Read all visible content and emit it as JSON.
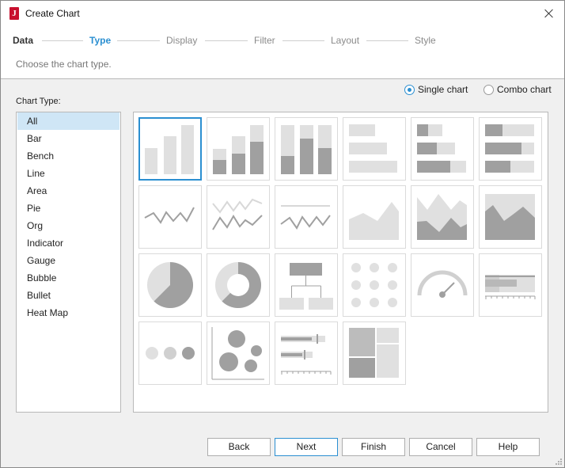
{
  "window": {
    "title": "Create Chart",
    "icon": "jreport-icon"
  },
  "steps": [
    "Data",
    "Type",
    "Display",
    "Filter",
    "Layout",
    "Style"
  ],
  "active_step": "Type",
  "subtitle": "Choose the chart type.",
  "mode_options": {
    "single": "Single chart",
    "combo": "Combo chart",
    "selected": "Single chart"
  },
  "chart_type_label": "Chart Type:",
  "chart_types": [
    "All",
    "Bar",
    "Bench",
    "Line",
    "Area",
    "Pie",
    "Org",
    "Indicator",
    "Gauge",
    "Bubble",
    "Bullet",
    "Heat Map"
  ],
  "selected_type": "All",
  "gallery": [
    {
      "icon": "bar-chart-icon"
    },
    {
      "icon": "stacked-bar-chart-icon"
    },
    {
      "icon": "stacked-bar-100-chart-icon"
    },
    {
      "icon": "bench-chart-icon"
    },
    {
      "icon": "stacked-bench-chart-icon"
    },
    {
      "icon": "stacked-bench-100-chart-icon"
    },
    {
      "icon": "line-chart-icon"
    },
    {
      "icon": "multi-line-chart-icon"
    },
    {
      "icon": "line-with-reference-chart-icon"
    },
    {
      "icon": "area-chart-icon"
    },
    {
      "icon": "stacked-area-chart-icon"
    },
    {
      "icon": "area-100-chart-icon"
    },
    {
      "icon": "pie-chart-icon"
    },
    {
      "icon": "donut-chart-icon"
    },
    {
      "icon": "org-chart-icon"
    },
    {
      "icon": "indicator-dots-icon"
    },
    {
      "icon": "gauge-chart-icon"
    },
    {
      "icon": "bullet-chart-icon"
    },
    {
      "icon": "bubble-row-chart-icon"
    },
    {
      "icon": "bubble-chart-icon"
    },
    {
      "icon": "bullet-bars-chart-icon"
    },
    {
      "icon": "heat-map-chart-icon"
    }
  ],
  "selected_gallery_index": 0,
  "buttons": {
    "back": "Back",
    "next": "Next",
    "finish": "Finish",
    "cancel": "Cancel",
    "help": "Help"
  },
  "colors": {
    "accent": "#2b8fd1",
    "selection_bg": "#cfe6f6",
    "app_icon": "#c8102e"
  }
}
